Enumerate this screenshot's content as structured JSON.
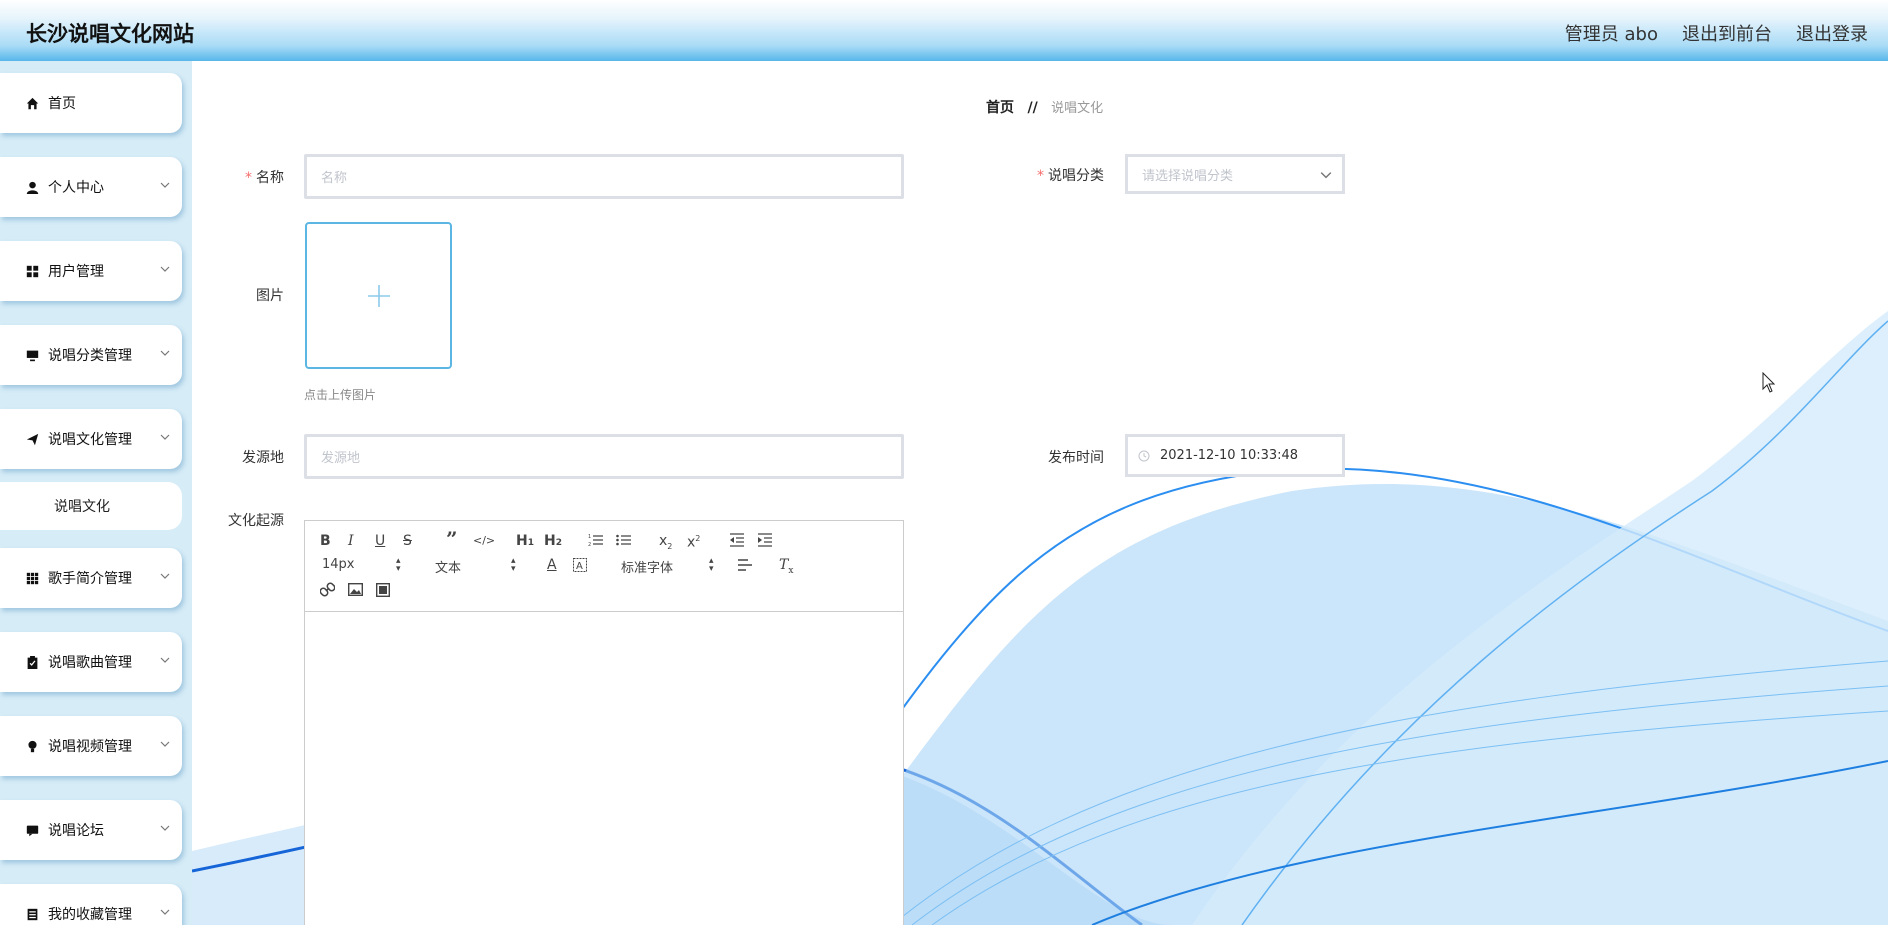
{
  "header": {
    "title": "长沙说唱文化网站",
    "admin": "管理员 abo",
    "exit_front": "退出到前台",
    "logout": "退出登录"
  },
  "sidebar": {
    "items": [
      {
        "label": "首页",
        "icon": "home-icon"
      },
      {
        "label": "个人中心",
        "icon": "user-icon"
      },
      {
        "label": "用户管理",
        "icon": "grid-icon"
      },
      {
        "label": "说唱分类管理",
        "icon": "monitor-icon"
      },
      {
        "label": "说唱文化管理",
        "icon": "send-icon"
      },
      {
        "label": "说唱文化",
        "icon": ""
      },
      {
        "label": "歌手简介管理",
        "icon": "apps-icon"
      },
      {
        "label": "说唱歌曲管理",
        "icon": "clipboard-icon"
      },
      {
        "label": "说唱视频管理",
        "icon": "bulb-icon"
      },
      {
        "label": "说唱论坛",
        "icon": "chat-icon"
      },
      {
        "label": "我的收藏管理",
        "icon": "list-icon"
      }
    ]
  },
  "breadcrumb": {
    "home": "首页",
    "separator": "//",
    "current": "说唱文化"
  },
  "form": {
    "name_label": "名称",
    "name_placeholder": "名称",
    "category_label": "说唱分类",
    "category_placeholder": "请选择说唱分类",
    "image_label": "图片",
    "upload_tip": "点击上传图片",
    "origin_label": "发源地",
    "origin_placeholder": "发源地",
    "time_label": "发布时间",
    "time_value": "2021-12-10 10:33:48",
    "culture_label": "文化起源",
    "required_mark": "*"
  },
  "editor": {
    "font_size": "14px",
    "header_select": "文本",
    "font_select": "标准字体"
  },
  "colors": {
    "accent": "#5cb6e4",
    "sidebar_bg": "#d6ecf7",
    "required": "#f56c6c"
  }
}
